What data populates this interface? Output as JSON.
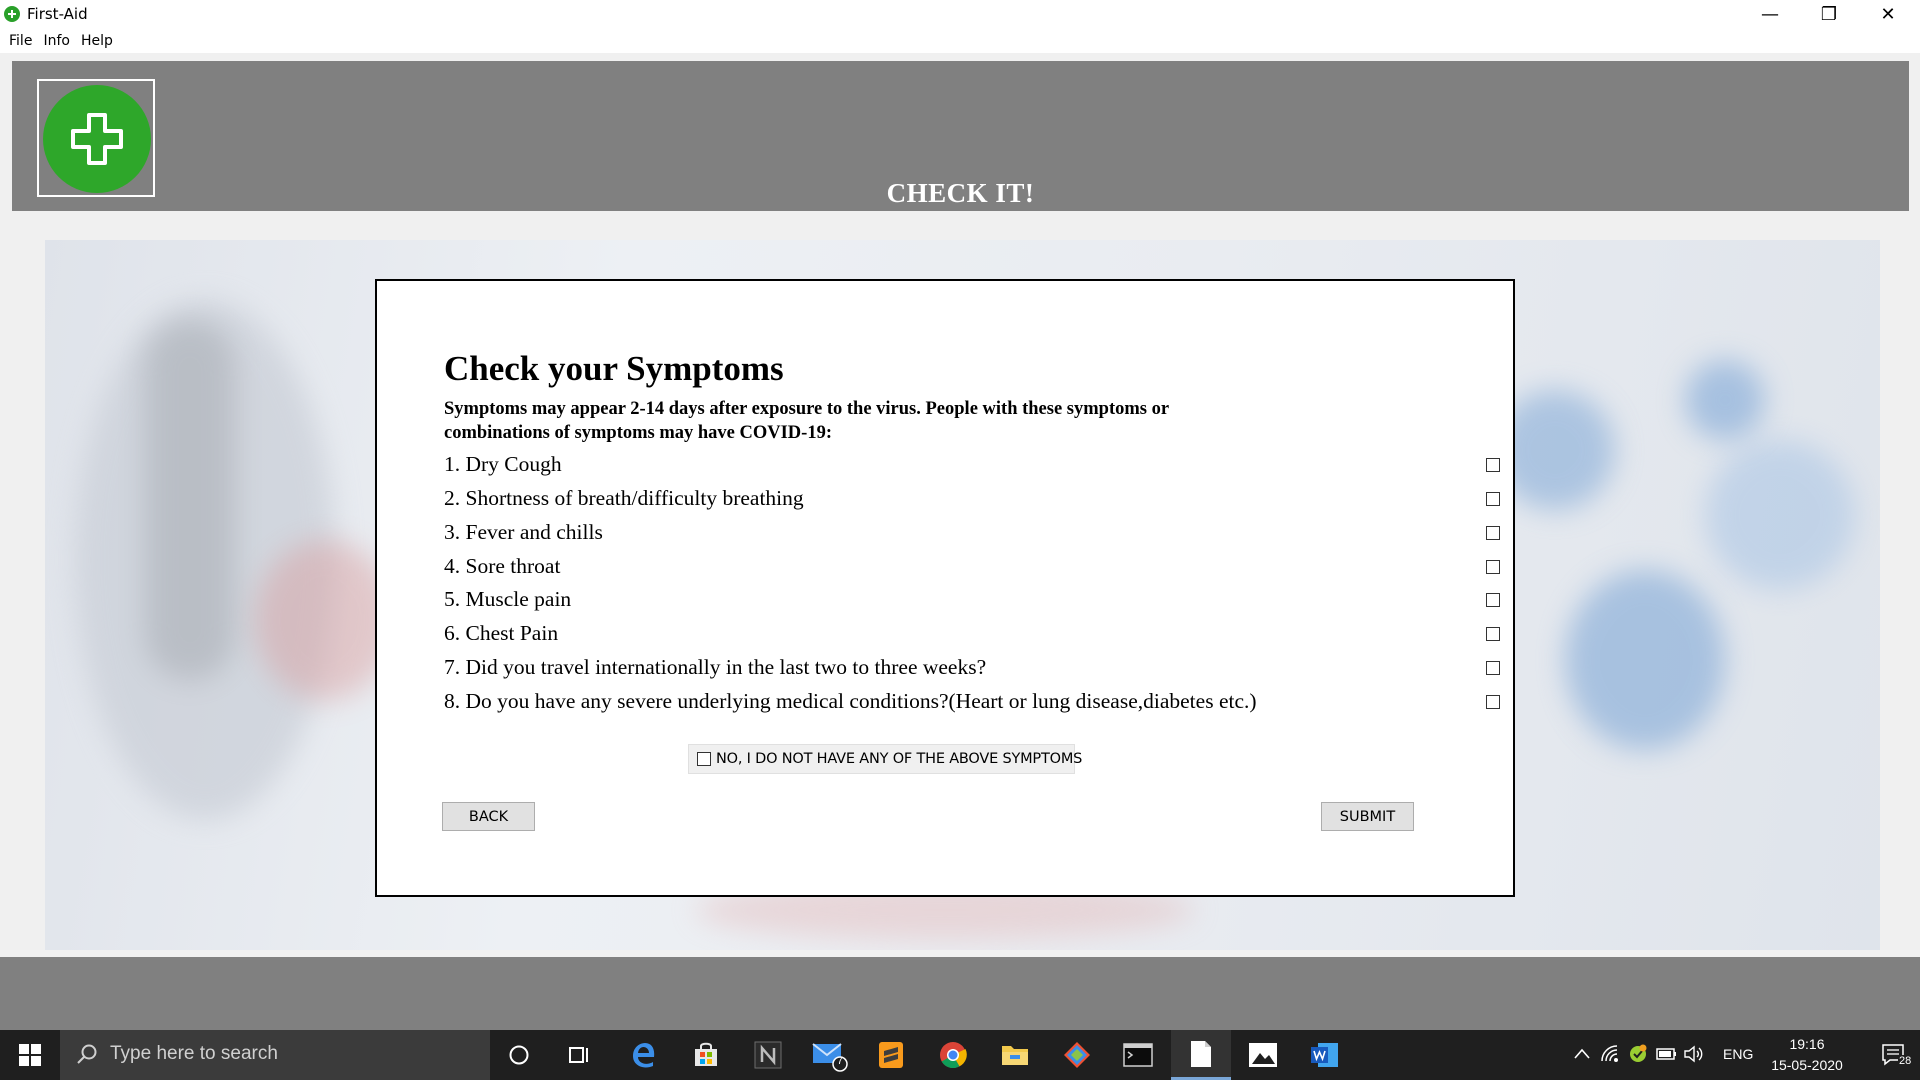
{
  "window": {
    "title": "First-Aid",
    "minimize": "—",
    "restore": "❐",
    "close": "✕"
  },
  "menu": [
    "File",
    "Info",
    "Help"
  ],
  "header": {
    "title": "CHECK IT!",
    "logo_icon": "medical-cross-icon",
    "logo_color": "#2ea72a"
  },
  "form": {
    "title": "Check your Symptoms",
    "subtitle": "Symptoms may appear 2-14 days after exposure to the virus. People with these symptoms or combinations of symptoms may have COVID-19:",
    "symptoms": [
      {
        "label": "1. Dry Cough",
        "checked": false
      },
      {
        "label": "2. Shortness of breath/difficulty breathing",
        "checked": false
      },
      {
        "label": "3. Fever and chills",
        "checked": false
      },
      {
        "label": "4. Sore throat",
        "checked": false
      },
      {
        "label": "5. Muscle pain",
        "checked": false
      },
      {
        "label": "6. Chest Pain",
        "checked": false
      },
      {
        "label": "7. Did you travel internationally in the last two to three weeks?",
        "checked": false
      },
      {
        "label": "8. Do you have any severe underlying medical conditions?(Heart or lung disease,diabetes etc.)",
        "checked": false
      }
    ],
    "none_option": {
      "label": "NO, I DO NOT HAVE ANY OF THE ABOVE SYMPTOMS",
      "checked": false
    },
    "back_label": "BACK",
    "submit_label": "SUBMIT"
  },
  "taskbar": {
    "search_placeholder": "Type here to search",
    "mail_badge": "7",
    "language": "ENG",
    "time": "19:16",
    "date": "15-05-2020",
    "notification_count": "28"
  }
}
